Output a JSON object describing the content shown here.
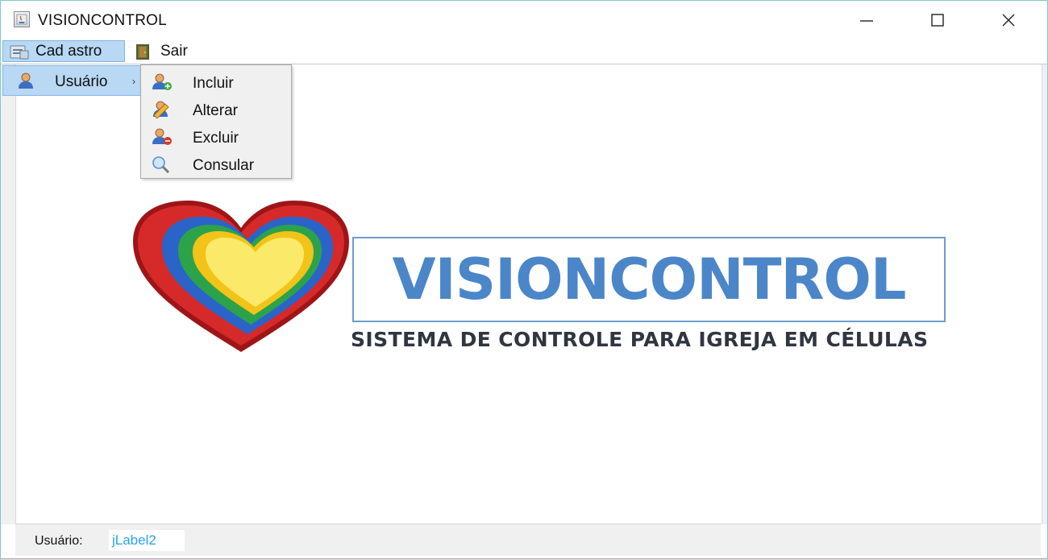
{
  "window": {
    "title": "VISIONCONTROL",
    "controls": {
      "minimize": "minimize",
      "maximize": "maximize",
      "close": "close"
    }
  },
  "menubar": {
    "items": [
      {
        "label": "Cad astro",
        "icon": "cadastro-icon",
        "active": true
      },
      {
        "label": "Sair",
        "icon": "exit-door-icon",
        "active": false
      }
    ]
  },
  "submenu": {
    "label": "Usuário",
    "icon": "user-icon",
    "arrow": "›",
    "items": [
      {
        "label": "Incluir",
        "icon": "user-add-icon"
      },
      {
        "label": "Alterar",
        "icon": "user-edit-icon"
      },
      {
        "label": "Excluir",
        "icon": "user-delete-icon"
      },
      {
        "label": "Consular",
        "icon": "search-icon"
      }
    ]
  },
  "logo": {
    "title": "VISIONCONTROL",
    "subtitle": "SISTEMA DE CONTROLE PARA IGREJA EM CÉLULAS",
    "colors": {
      "title": "#4b86c9",
      "subtitle": "#2f3640",
      "border": "#6e9bd2"
    }
  },
  "statusbar": {
    "label": "Usuário:",
    "value": "jLabel2"
  },
  "colors": {
    "menu_highlight": "#b8d8f4",
    "menu_highlight_border": "#7db4e4",
    "status_value": "#2aa3e6"
  }
}
